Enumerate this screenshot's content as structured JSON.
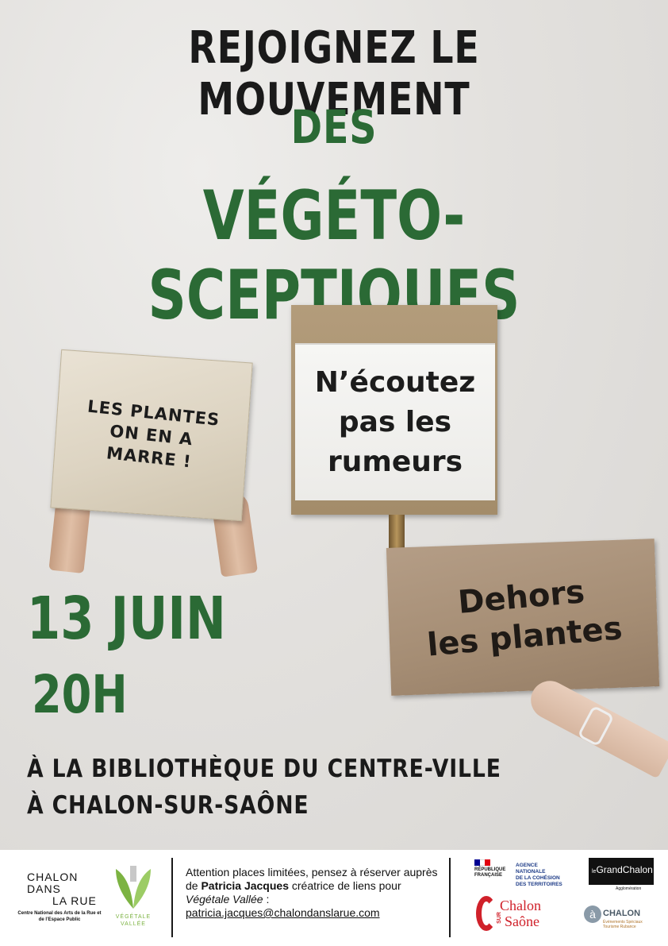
{
  "headline": {
    "line1": "REJOIGNEZ LE MOUVEMENT",
    "line2": "DES",
    "line3": "VÉGÉTO-SCEPTIQUES"
  },
  "signs": {
    "left": "LES PLANTES\nON EN A\nMARRE !",
    "middle": "N’écoutez\npas les\nrumeurs",
    "right": "Dehors\nles plantes"
  },
  "event": {
    "date": "13 JUIN",
    "time": "20H",
    "venue_line1": "À LA BIBLIOTHÈQUE DU CENTRE-VILLE",
    "venue_line2": "À CHALON-SUR-SAÔNE"
  },
  "footer": {
    "cdlr_logo": {
      "word1": "CHALON",
      "word2": "DANS",
      "word3": "LA RUE",
      "caption": "Centre National des Arts de la Rue et de l’Espace Public"
    },
    "vv_logo": {
      "line1": "VÉGÉTALE",
      "line2": "VALLÉE"
    },
    "info": {
      "part1": "Attention places limitées, pensez à réserver auprès de ",
      "name": "Patricia Jacques",
      "part2": " créatrice de liens pour ",
      "company": "Végétale Vallée",
      "part3": " :",
      "email": "patricia.jacques@chalondanslarue.com"
    },
    "rf_logo": {
      "text": "RÉPUBLIQUE\nFRANÇAISE",
      "flag_colors": [
        "#000091",
        "#ffffff",
        "#e1000f"
      ]
    },
    "anct_logo": "AGENCE\nNATIONALE\nDE LA COHÉSION\nDES TERRITOIRES",
    "chalon_logo": {
      "top": "Chalon",
      "sur": "SUR",
      "bottom": "Saône"
    },
    "grandchalon_logo": {
      "le": "le",
      "name": "GrandChalon",
      "sub": "Agglomération"
    },
    "chalon_tourisme_logo": {
      "initial": "à",
      "name": "CHALON",
      "sub": "Événements Spéciaux\nTourisme Rubance"
    }
  },
  "colors": {
    "green": "#2b6a35",
    "dark": "#1a1a1a",
    "chalon_red": "#d0212a"
  }
}
